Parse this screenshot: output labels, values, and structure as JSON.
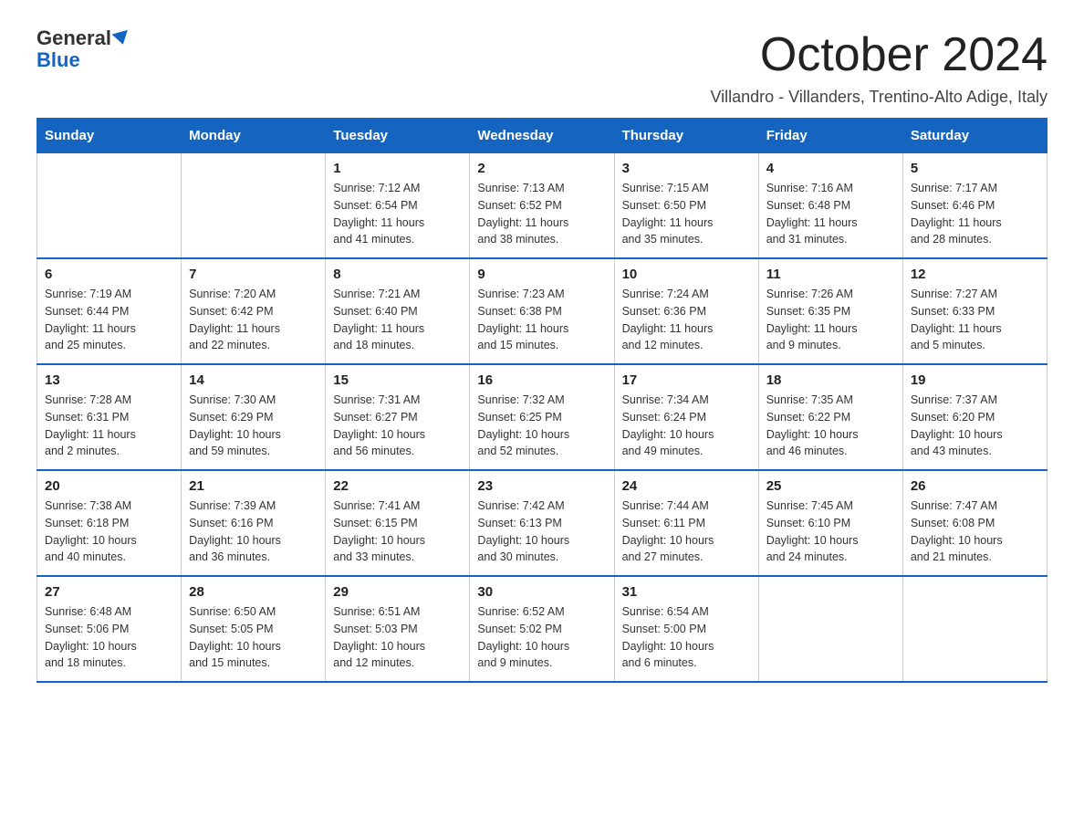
{
  "logo": {
    "general": "General",
    "blue": "Blue",
    "triangle_aria": "logo-triangle"
  },
  "header": {
    "month_year": "October 2024",
    "subtitle": "Villandro - Villanders, Trentino-Alto Adige, Italy"
  },
  "weekdays": [
    "Sunday",
    "Monday",
    "Tuesday",
    "Wednesday",
    "Thursday",
    "Friday",
    "Saturday"
  ],
  "weeks": [
    [
      {
        "day": "",
        "info": ""
      },
      {
        "day": "",
        "info": ""
      },
      {
        "day": "1",
        "info": "Sunrise: 7:12 AM\nSunset: 6:54 PM\nDaylight: 11 hours\nand 41 minutes."
      },
      {
        "day": "2",
        "info": "Sunrise: 7:13 AM\nSunset: 6:52 PM\nDaylight: 11 hours\nand 38 minutes."
      },
      {
        "day": "3",
        "info": "Sunrise: 7:15 AM\nSunset: 6:50 PM\nDaylight: 11 hours\nand 35 minutes."
      },
      {
        "day": "4",
        "info": "Sunrise: 7:16 AM\nSunset: 6:48 PM\nDaylight: 11 hours\nand 31 minutes."
      },
      {
        "day": "5",
        "info": "Sunrise: 7:17 AM\nSunset: 6:46 PM\nDaylight: 11 hours\nand 28 minutes."
      }
    ],
    [
      {
        "day": "6",
        "info": "Sunrise: 7:19 AM\nSunset: 6:44 PM\nDaylight: 11 hours\nand 25 minutes."
      },
      {
        "day": "7",
        "info": "Sunrise: 7:20 AM\nSunset: 6:42 PM\nDaylight: 11 hours\nand 22 minutes."
      },
      {
        "day": "8",
        "info": "Sunrise: 7:21 AM\nSunset: 6:40 PM\nDaylight: 11 hours\nand 18 minutes."
      },
      {
        "day": "9",
        "info": "Sunrise: 7:23 AM\nSunset: 6:38 PM\nDaylight: 11 hours\nand 15 minutes."
      },
      {
        "day": "10",
        "info": "Sunrise: 7:24 AM\nSunset: 6:36 PM\nDaylight: 11 hours\nand 12 minutes."
      },
      {
        "day": "11",
        "info": "Sunrise: 7:26 AM\nSunset: 6:35 PM\nDaylight: 11 hours\nand 9 minutes."
      },
      {
        "day": "12",
        "info": "Sunrise: 7:27 AM\nSunset: 6:33 PM\nDaylight: 11 hours\nand 5 minutes."
      }
    ],
    [
      {
        "day": "13",
        "info": "Sunrise: 7:28 AM\nSunset: 6:31 PM\nDaylight: 11 hours\nand 2 minutes."
      },
      {
        "day": "14",
        "info": "Sunrise: 7:30 AM\nSunset: 6:29 PM\nDaylight: 10 hours\nand 59 minutes."
      },
      {
        "day": "15",
        "info": "Sunrise: 7:31 AM\nSunset: 6:27 PM\nDaylight: 10 hours\nand 56 minutes."
      },
      {
        "day": "16",
        "info": "Sunrise: 7:32 AM\nSunset: 6:25 PM\nDaylight: 10 hours\nand 52 minutes."
      },
      {
        "day": "17",
        "info": "Sunrise: 7:34 AM\nSunset: 6:24 PM\nDaylight: 10 hours\nand 49 minutes."
      },
      {
        "day": "18",
        "info": "Sunrise: 7:35 AM\nSunset: 6:22 PM\nDaylight: 10 hours\nand 46 minutes."
      },
      {
        "day": "19",
        "info": "Sunrise: 7:37 AM\nSunset: 6:20 PM\nDaylight: 10 hours\nand 43 minutes."
      }
    ],
    [
      {
        "day": "20",
        "info": "Sunrise: 7:38 AM\nSunset: 6:18 PM\nDaylight: 10 hours\nand 40 minutes."
      },
      {
        "day": "21",
        "info": "Sunrise: 7:39 AM\nSunset: 6:16 PM\nDaylight: 10 hours\nand 36 minutes."
      },
      {
        "day": "22",
        "info": "Sunrise: 7:41 AM\nSunset: 6:15 PM\nDaylight: 10 hours\nand 33 minutes."
      },
      {
        "day": "23",
        "info": "Sunrise: 7:42 AM\nSunset: 6:13 PM\nDaylight: 10 hours\nand 30 minutes."
      },
      {
        "day": "24",
        "info": "Sunrise: 7:44 AM\nSunset: 6:11 PM\nDaylight: 10 hours\nand 27 minutes."
      },
      {
        "day": "25",
        "info": "Sunrise: 7:45 AM\nSunset: 6:10 PM\nDaylight: 10 hours\nand 24 minutes."
      },
      {
        "day": "26",
        "info": "Sunrise: 7:47 AM\nSunset: 6:08 PM\nDaylight: 10 hours\nand 21 minutes."
      }
    ],
    [
      {
        "day": "27",
        "info": "Sunrise: 6:48 AM\nSunset: 5:06 PM\nDaylight: 10 hours\nand 18 minutes."
      },
      {
        "day": "28",
        "info": "Sunrise: 6:50 AM\nSunset: 5:05 PM\nDaylight: 10 hours\nand 15 minutes."
      },
      {
        "day": "29",
        "info": "Sunrise: 6:51 AM\nSunset: 5:03 PM\nDaylight: 10 hours\nand 12 minutes."
      },
      {
        "day": "30",
        "info": "Sunrise: 6:52 AM\nSunset: 5:02 PM\nDaylight: 10 hours\nand 9 minutes."
      },
      {
        "day": "31",
        "info": "Sunrise: 6:54 AM\nSunset: 5:00 PM\nDaylight: 10 hours\nand 6 minutes."
      },
      {
        "day": "",
        "info": ""
      },
      {
        "day": "",
        "info": ""
      }
    ]
  ]
}
